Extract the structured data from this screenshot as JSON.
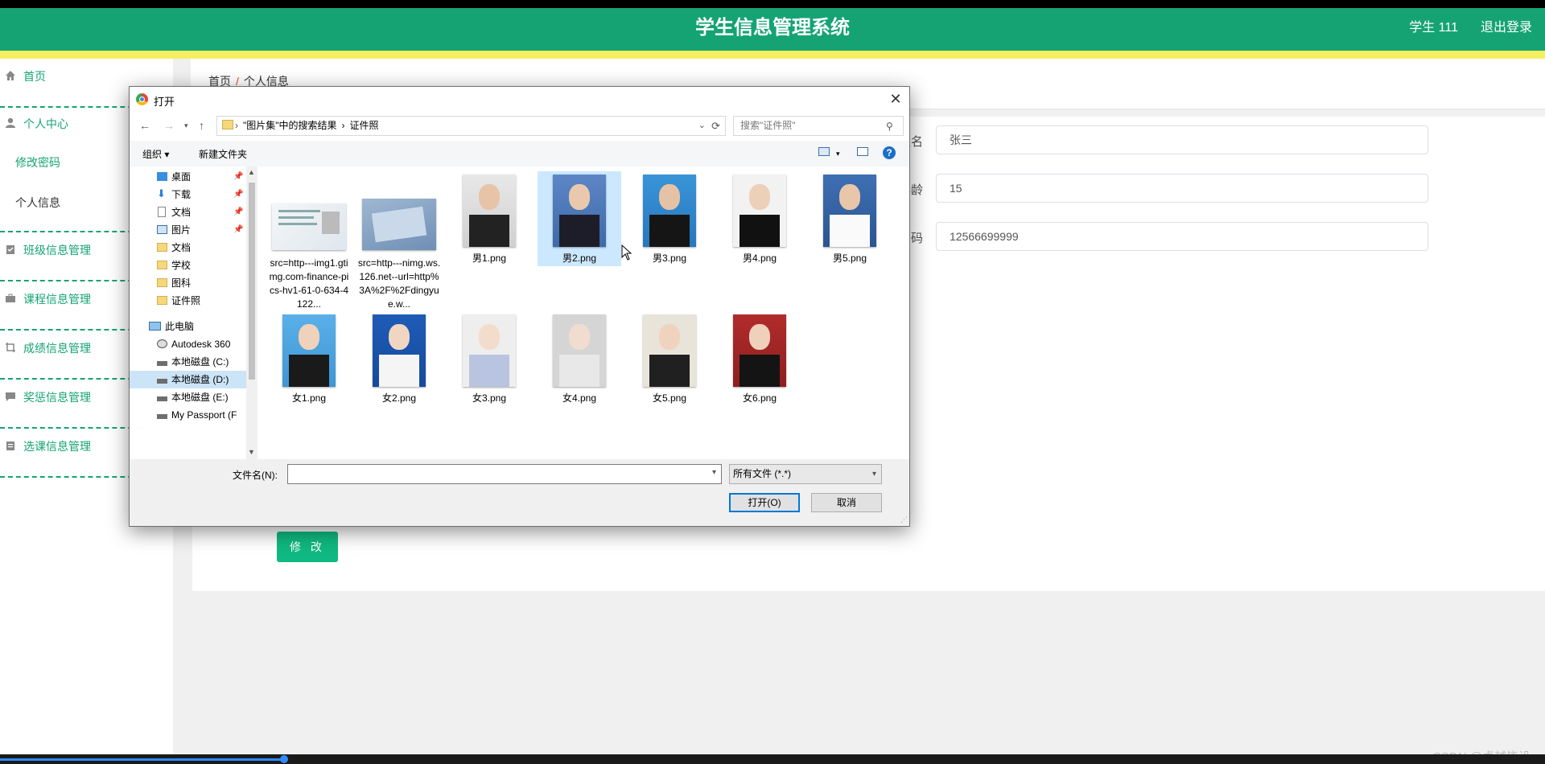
{
  "app": {
    "title": "学生信息管理系统",
    "user": "学生 111",
    "logout": "退出登录",
    "colors": {
      "primary": "#15a374",
      "accent_bar": "#f5ef5f",
      "button": "#10b981"
    }
  },
  "sidebar": {
    "items": [
      {
        "label": "首页",
        "icon": "home-icon"
      },
      {
        "label": "个人中心",
        "icon": "user-icon"
      },
      {
        "label": "修改密码"
      },
      {
        "label": "个人信息"
      },
      {
        "label": "班级信息管理",
        "icon": "clipboard-check-icon"
      },
      {
        "label": "课程信息管理",
        "icon": "briefcase-icon"
      },
      {
        "label": "成绩信息管理",
        "icon": "crop-icon"
      },
      {
        "label": "奖惩信息管理",
        "icon": "comment-icon"
      },
      {
        "label": "选课信息管理",
        "icon": "clipboard-icon"
      }
    ]
  },
  "breadcrumb": {
    "home": "首页",
    "current": "个人信息"
  },
  "form": {
    "fields": [
      {
        "label": "姓名",
        "value": "张三"
      },
      {
        "label": "年龄",
        "value": "15"
      },
      {
        "label": "号码",
        "value": "12566699999"
      }
    ],
    "submit": "修 改"
  },
  "dialog": {
    "title": "打开",
    "path": [
      "\"图片集\"中的搜索结果",
      "证件照"
    ],
    "search_placeholder": "搜索\"证件照\"",
    "toolbar": {
      "organize": "组织 ▾",
      "new_folder": "新建文件夹"
    },
    "tree": [
      {
        "label": "桌面",
        "pinned": true
      },
      {
        "label": "下载",
        "pinned": true
      },
      {
        "label": "文档",
        "pinned": true
      },
      {
        "label": "图片",
        "pinned": true
      },
      {
        "label": "文档"
      },
      {
        "label": "学校"
      },
      {
        "label": "图科"
      },
      {
        "label": "证件照"
      },
      {
        "label": "此电脑"
      },
      {
        "label": "Autodesk 360"
      },
      {
        "label": "本地磁盘 (C:)"
      },
      {
        "label": "本地磁盘 (D:)",
        "selected": true
      },
      {
        "label": "本地磁盘 (E:)"
      },
      {
        "label": "My Passport (F"
      }
    ],
    "files": [
      {
        "name": "src=http---img1.gtimg.com-finance-pics-hv1-61-0-634-4122..."
      },
      {
        "name": "src=http---nimg.ws.126.net--url=http%3A%2F%2Fdingyue.w..."
      },
      {
        "name": "男1.png"
      },
      {
        "name": "男2.png",
        "selected": true
      },
      {
        "name": "男3.png"
      },
      {
        "name": "男4.png"
      },
      {
        "name": "男5.png"
      },
      {
        "name": "女1.png"
      },
      {
        "name": "女2.png"
      },
      {
        "name": "女3.png"
      },
      {
        "name": "女4.png"
      },
      {
        "name": "女5.png"
      },
      {
        "name": "女6.png"
      }
    ],
    "filename_label": "文件名(N):",
    "filename_value": "",
    "filetype": "所有文件 (*.*)",
    "open_button": "打开(O)",
    "cancel_button": "取消"
  },
  "watermark": "CSDN @卓越毕设",
  "video_progress": 0.184
}
